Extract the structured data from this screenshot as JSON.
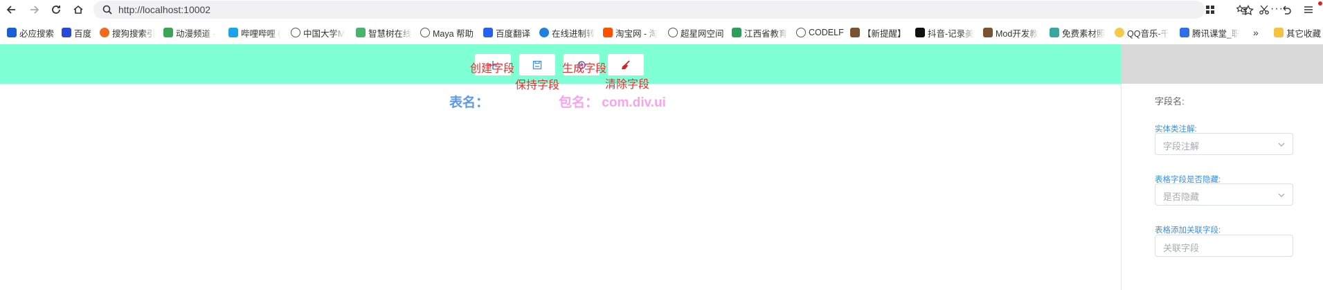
{
  "browser": {
    "url": "http://localhost:10002",
    "bookmarks": [
      {
        "label": "必应搜索",
        "color": "#1a5fd6"
      },
      {
        "label": "百度",
        "color": "#2b48d8"
      },
      {
        "label": "搜狗搜索引",
        "color": "#f26b1d"
      },
      {
        "label": "动漫频道 -",
        "color": "#3aa655"
      },
      {
        "label": "哔哩哔哩 (",
        "color": "#1aa3e8"
      },
      {
        "label": "中国大学M",
        "color": "#555555"
      },
      {
        "label": "智慧树在线",
        "color": "#48b36a"
      },
      {
        "label": "Maya 帮助",
        "color": "#555555"
      },
      {
        "label": "百度翻译",
        "color": "#2563eb"
      },
      {
        "label": "在线进制转",
        "color": "#2080e0"
      },
      {
        "label": "淘宝网 - 淘",
        "color": "#ff5000"
      },
      {
        "label": "超星网空间",
        "color": "#555555"
      },
      {
        "label": "江西省教育",
        "color": "#2e9e5b"
      },
      {
        "label": "CODELF",
        "color": "#555555"
      },
      {
        "label": "【新提醒】",
        "color": "#7a5230"
      },
      {
        "label": "抖音-记录美",
        "color": "#111111"
      },
      {
        "label": "Mod开发教",
        "color": "#7a5230"
      },
      {
        "label": "免费素材照",
        "color": "#3aa6a0"
      },
      {
        "label": "QQ音乐-千",
        "color": "#f7c948"
      },
      {
        "label": "腾讯课堂_职",
        "color": "#2f6fe8"
      }
    ],
    "other_bookmarks": "其它收藏"
  },
  "toolbar": {
    "create_label": "创建字段",
    "save_label": "保持字段",
    "generate_label": "生成字段",
    "clear_label": "清除字段"
  },
  "info": {
    "table_name": "表名：",
    "package_name": "包名： com.div.ui"
  },
  "panel": {
    "field_name_label": "字段名:",
    "entity_annotation_label": "实体类注解:",
    "entity_annotation_placeholder": "字段注解",
    "hidden_label": "表格字段是否隐藏:",
    "hidden_placeholder": "是否隐藏",
    "related_label": "表格添加关联字段:",
    "related_placeholder": "关联字段"
  },
  "colors": {
    "header_bg": "#7fffd4",
    "label_red": "#e83030",
    "table_name_blue": "#5b9be6",
    "package_pink": "#f8a3ee",
    "form_label_blue": "#3a8ee6"
  }
}
